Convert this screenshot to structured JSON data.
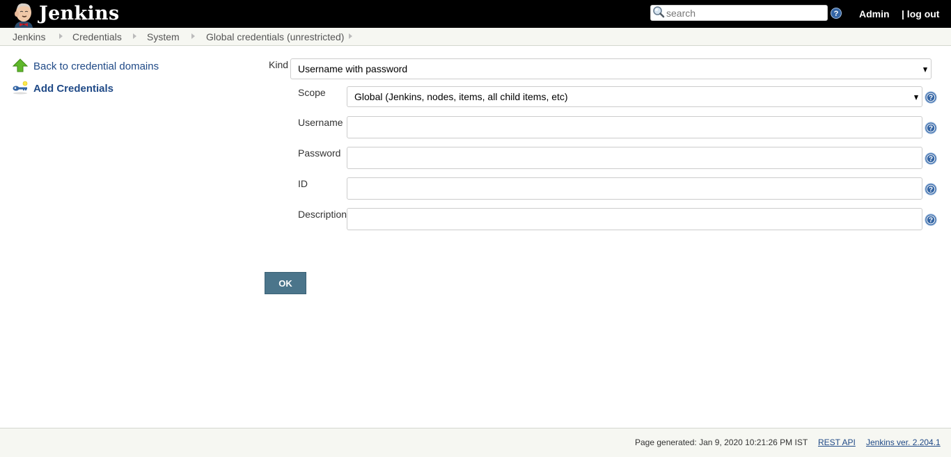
{
  "header": {
    "app_title": "Jenkins",
    "search_placeholder": "search",
    "search_value": "",
    "user_name": "Admin",
    "logout_label": "| log out",
    "icons": {
      "logo": "jenkins-butler-icon",
      "search": "magnifier-icon",
      "help": "help-icon"
    }
  },
  "breadcrumbs": [
    {
      "label": "Jenkins"
    },
    {
      "label": "Credentials"
    },
    {
      "label": "System"
    },
    {
      "label": "Global credentials (unrestricted)"
    }
  ],
  "sidebar": {
    "items": [
      {
        "label": "Back to credential domains",
        "icon": "up-arrow-icon",
        "bold": false
      },
      {
        "label": "Add Credentials",
        "icon": "key-icon",
        "bold": true
      }
    ]
  },
  "form": {
    "kind": {
      "label": "Kind",
      "value": "Username with password"
    },
    "fields": [
      {
        "label": "Scope",
        "type": "select",
        "value": "Global (Jenkins, nodes, items, all child items, etc)"
      },
      {
        "label": "Username",
        "type": "text",
        "value": ""
      },
      {
        "label": "Password",
        "type": "password",
        "value": ""
      },
      {
        "label": "ID",
        "type": "text",
        "value": ""
      },
      {
        "label": "Description",
        "type": "text",
        "value": ""
      }
    ],
    "submit_label": "OK"
  },
  "footer": {
    "page_generated": "Page generated: Jan 9, 2020 10:21:26 PM IST",
    "rest_api_label": "REST API",
    "version_label": "Jenkins ver. 2.204.1"
  },
  "colors": {
    "header_bg": "#000000",
    "breadcrumb_bg": "#f6f7f2",
    "link": "#204a87",
    "button": "#4b758b"
  }
}
